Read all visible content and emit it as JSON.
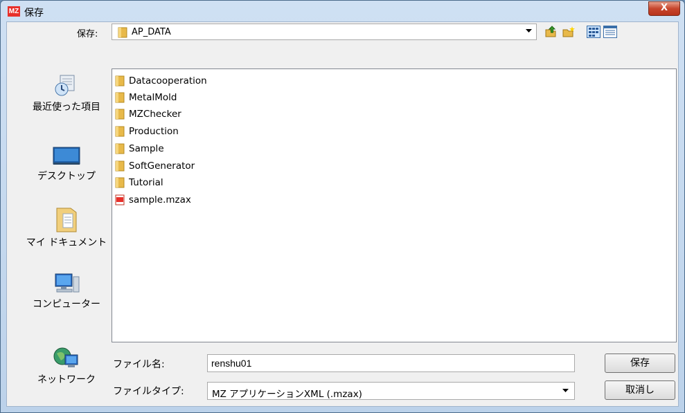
{
  "window": {
    "title": "保存",
    "app_logo": "MZ",
    "close_label": "X"
  },
  "save_in": {
    "label": "保存:",
    "value": "AP_DATA"
  },
  "toolbar": {
    "icons": [
      "up-folder-icon",
      "new-folder-icon",
      "list-view-icon",
      "details-view-icon"
    ]
  },
  "places": [
    {
      "label": "最近使った項目",
      "icon": "recent-items-icon"
    },
    {
      "label": "デスクトップ",
      "icon": "desktop-icon"
    },
    {
      "label": "マイ ドキュメント",
      "icon": "my-documents-icon"
    },
    {
      "label": "コンピューター",
      "icon": "computer-icon"
    },
    {
      "label": "ネットワーク",
      "icon": "network-icon"
    }
  ],
  "files": [
    {
      "name": "Datacooperation",
      "type": "folder"
    },
    {
      "name": "MetalMold",
      "type": "folder"
    },
    {
      "name": "MZChecker",
      "type": "folder"
    },
    {
      "name": "Production",
      "type": "folder"
    },
    {
      "name": "Sample",
      "type": "folder"
    },
    {
      "name": "SoftGenerator",
      "type": "folder"
    },
    {
      "name": "Tutorial",
      "type": "folder"
    },
    {
      "name": "sample.mzax",
      "type": "file"
    }
  ],
  "filename": {
    "label": "ファイル名:",
    "value": "renshu01"
  },
  "filetype": {
    "label": "ファイルタイプ:",
    "value": "MZ アプリケーションXML (.mzax)"
  },
  "buttons": {
    "save": "保存",
    "cancel": "取消し"
  },
  "colors": {
    "accent_red": "#e8302a",
    "folder": "#e8b94a",
    "selection": "#cce8ff"
  }
}
